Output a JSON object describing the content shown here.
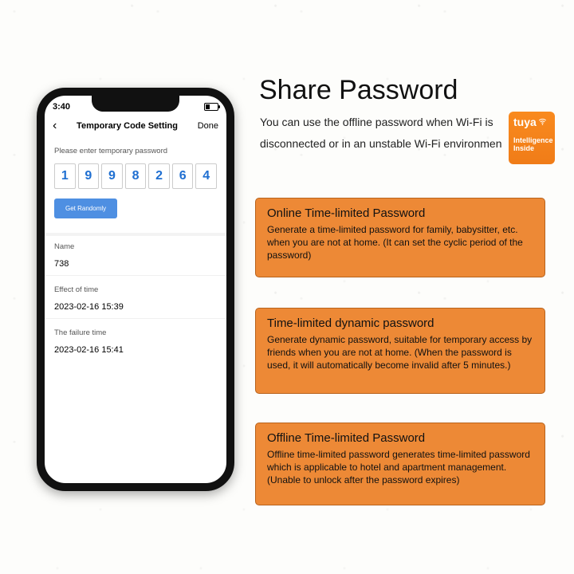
{
  "phone": {
    "time": "3:40",
    "nav": {
      "title": "Temporary Code Setting",
      "done": "Done"
    },
    "prompt_label": "Please enter temporary password",
    "digits": [
      "1",
      "9",
      "9",
      "8",
      "2",
      "6",
      "4"
    ],
    "get_random_label": "Get Randomly",
    "name_label": "Name",
    "name_value": "738",
    "effect_label": "Effect of time",
    "effect_value": "2023-02-16 15:39",
    "failure_label": "The failure time",
    "failure_value": "2023-02-16 15:41"
  },
  "right": {
    "headline": "Share Password",
    "sub": "You can use the offline password when Wi-Fi is disconnected or in an unstable Wi-Fi environmen",
    "tuya": {
      "brand": "tuya",
      "line1": "Intelligence",
      "line2": "Inside"
    },
    "cards": [
      {
        "title": "Online Time-limited Password",
        "body": "Generate a time-limited password for family, babysitter, etc. when you are not at home.  (It can set the cyclic period of the password)"
      },
      {
        "title": "Time-limited dynamic password",
        "body": "Generate dynamic password, suitable for temporary access by friends when you are not at home. (When the password is used, it will automatically become invalid after 5 minutes.)"
      },
      {
        "title": "Offline Time-limited Password",
        "body": "Offline time-limited password generates time-limited password which is applicable to hotel and apartment management. (Unable to unlock after the password expires)"
      }
    ]
  }
}
